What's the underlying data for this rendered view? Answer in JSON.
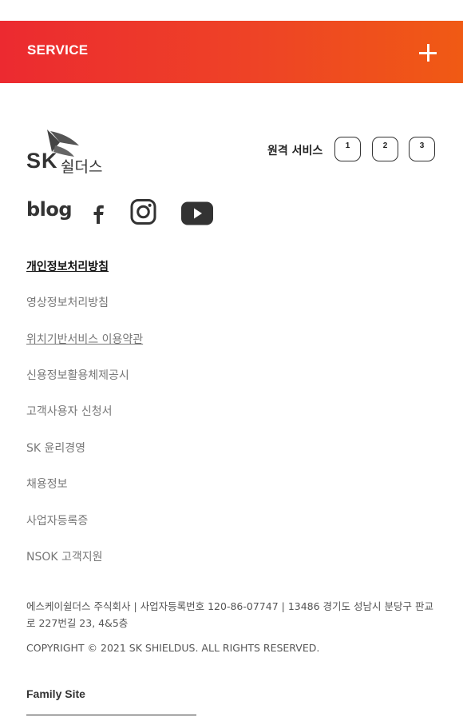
{
  "service": {
    "label": "SERVICE"
  },
  "logo": {
    "brand": "SK",
    "name": "쉴더스"
  },
  "remote": {
    "label": "원격 서비스",
    "buttons": [
      "1",
      "2",
      "3"
    ]
  },
  "social": {
    "blog": "blog"
  },
  "links": [
    "개인정보처리방침",
    "영상정보처리방침",
    "위치기반서비스 이용약관",
    "신용정보활용체제공시",
    "고객사용자 신청서",
    "SK 윤리경영",
    "채용정보",
    "사업자등록증",
    "NSOK 고객지원"
  ],
  "footer": {
    "address": "에스케이쉴더스 주식회사 | 사업자등록번호 120-86-07747 | 13486 경기도 성남시 분당구 판교로 227번길 23, 4&5층",
    "copyright": "COPYRIGHT © 2021 SK SHIELDUS. ALL RIGHTS RESERVED.",
    "family_site": "Family Site"
  }
}
